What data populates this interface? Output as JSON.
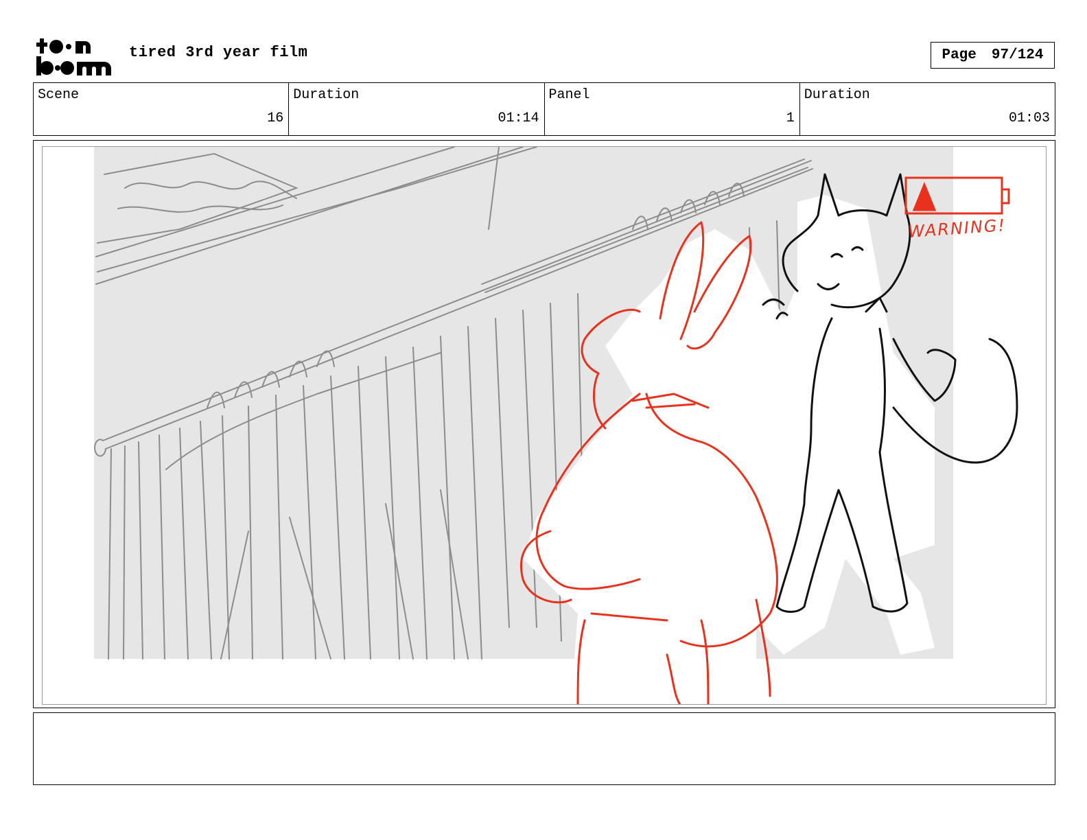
{
  "header": {
    "brand_logo_text": "toonboom",
    "project_title": "tired 3rd year film",
    "page_label": "Page",
    "page_value": "97/124"
  },
  "info": [
    {
      "label": "Scene",
      "value": "16"
    },
    {
      "label": "Duration",
      "value": "01:14"
    },
    {
      "label": "Panel",
      "value": "1"
    },
    {
      "label": "Duration",
      "value": "01:03"
    }
  ],
  "drawing": {
    "warning_text": "WARNING!",
    "colors": {
      "background_tone": "#e6e6e6",
      "rough_pencil": "#8c8c8c",
      "rabbit_red": "#e8321e",
      "cat_black": "#111111"
    }
  },
  "notes": {
    "text": ""
  }
}
